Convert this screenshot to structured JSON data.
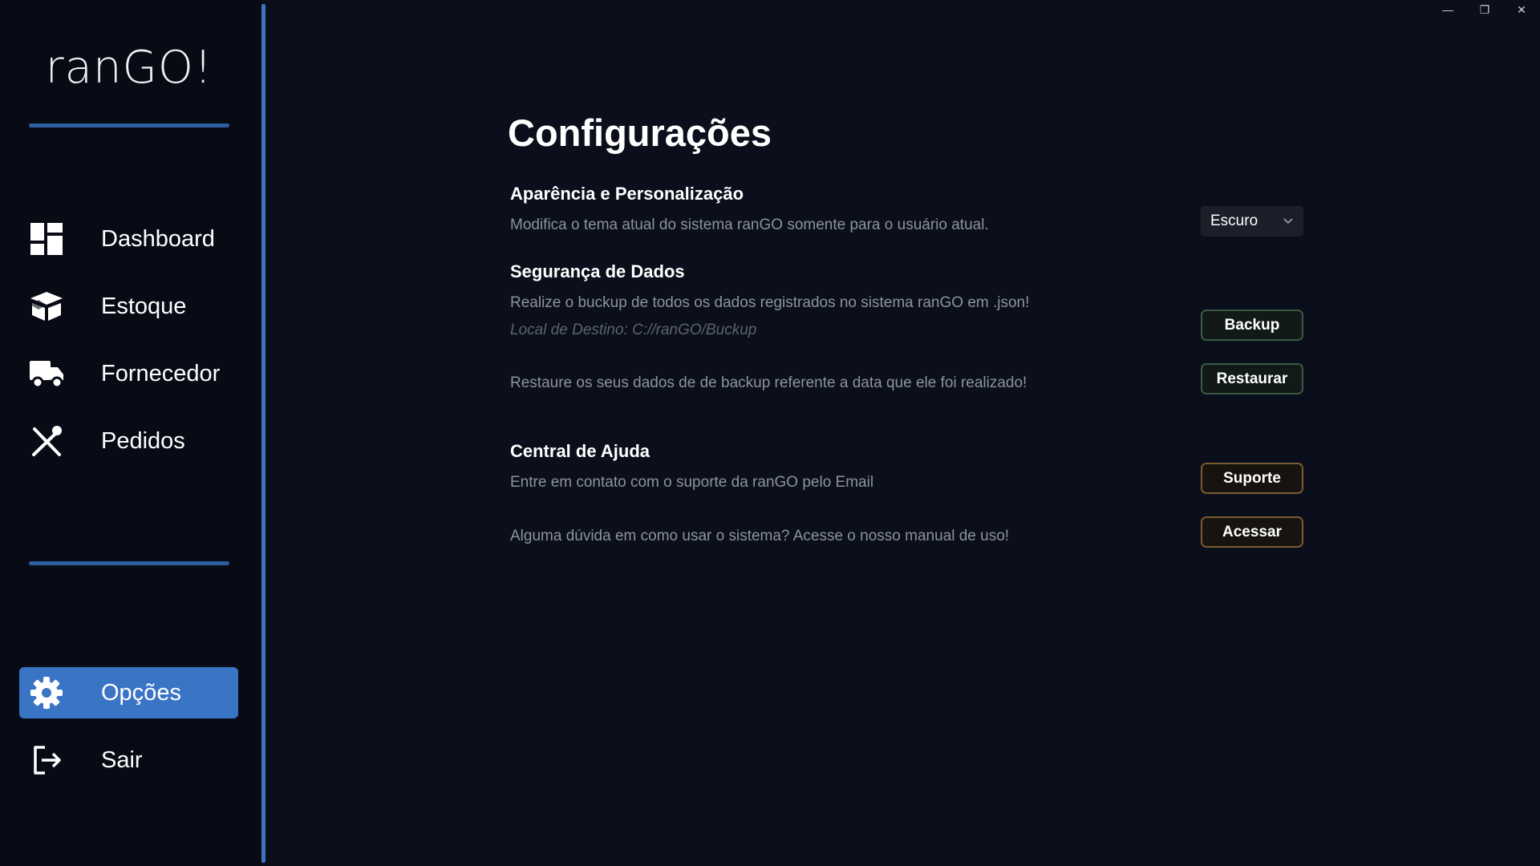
{
  "app": {
    "logo": "ranGO!"
  },
  "sidebar": {
    "items": [
      {
        "label": "Dashboard",
        "icon": "dashboard-icon"
      },
      {
        "label": "Estoque",
        "icon": "box-icon"
      },
      {
        "label": "Fornecedor",
        "icon": "truck-icon"
      },
      {
        "label": "Pedidos",
        "icon": "utensils-icon"
      }
    ],
    "bottom_items": [
      {
        "label": "Opções",
        "icon": "gear-icon",
        "active": true
      },
      {
        "label": "Sair",
        "icon": "logout-icon"
      }
    ]
  },
  "window_controls": {
    "minimize": "—",
    "restore": "❐",
    "close": "✕"
  },
  "main": {
    "title": "Configurações",
    "appearance": {
      "title": "Aparência e Personalização",
      "desc": "Modifica o tema atual do sistema ranGO somente para o usuário atual.",
      "theme_value": "Escuro"
    },
    "security": {
      "title": "Segurança de Dados",
      "backup_desc": "Realize o buckup de todos os dados registrados no sistema ranGO em .json!",
      "backup_path": "Local de Destino: C://ranGO/Buckup",
      "backup_button": "Backup",
      "restore_desc": "Restaure os seus dados de de backup referente a data que ele foi realizado!",
      "restore_button": "Restaurar"
    },
    "help": {
      "title": "Central de Ajuda",
      "support_desc": "Entre em contato com o suporte da ranGO pelo Email",
      "support_button": "Suporte",
      "manual_desc": "Alguma dúvida em como usar o sistema? Acesse o nosso manual de uso!",
      "manual_button": "Acessar"
    }
  },
  "colors": {
    "accent": "#3a74c4",
    "background": "#0b0f1c",
    "sidebar": "#080b16"
  }
}
